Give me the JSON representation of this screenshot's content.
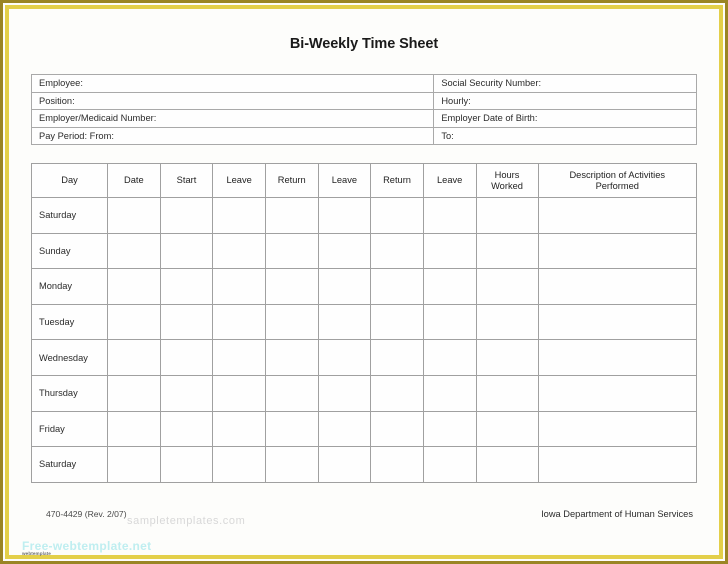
{
  "document": {
    "title": "Bi-Weekly Time Sheet"
  },
  "info_table": {
    "rows": [
      {
        "left": "Employee:",
        "right": "Social Security Number:"
      },
      {
        "left": "Position:",
        "right": "Hourly:"
      },
      {
        "left": "Employer/Medicaid Number:",
        "right": "Employer Date of Birth:"
      },
      {
        "left": "Pay Period:  From:",
        "right": "To:"
      }
    ]
  },
  "grid": {
    "headers": [
      "Day",
      "Date",
      "Start",
      "Leave",
      "Return",
      "Leave",
      "Return",
      "Leave",
      "Hours Worked",
      "Description of Activities Performed"
    ],
    "header_lines": {
      "hours_worked": [
        "Hours",
        "Worked"
      ],
      "description": [
        "Description of Activities",
        "Performed"
      ]
    },
    "days": [
      "Saturday",
      "Sunday",
      "Monday",
      "Tuesday",
      "Wednesday",
      "Thursday",
      "Friday",
      "Saturday"
    ],
    "empty_cell_value": ""
  },
  "footer": {
    "form_number": "470-4429  (Rev. 2/07)",
    "agency": "Iowa Department of Human Services"
  },
  "watermarks": {
    "gray_text": "sampletemplates.com",
    "cyan_text": "Free-webtemplate.net",
    "cyan_subtext": "webtemplate"
  },
  "colors": {
    "page_border_outer": "#9a8524",
    "page_border_inner": "#e3cf49",
    "paper": "#fdfdfb",
    "rule": "#a0a0a0",
    "text": "#2b2b2b",
    "watermark_cyan": "#bfeef0"
  }
}
